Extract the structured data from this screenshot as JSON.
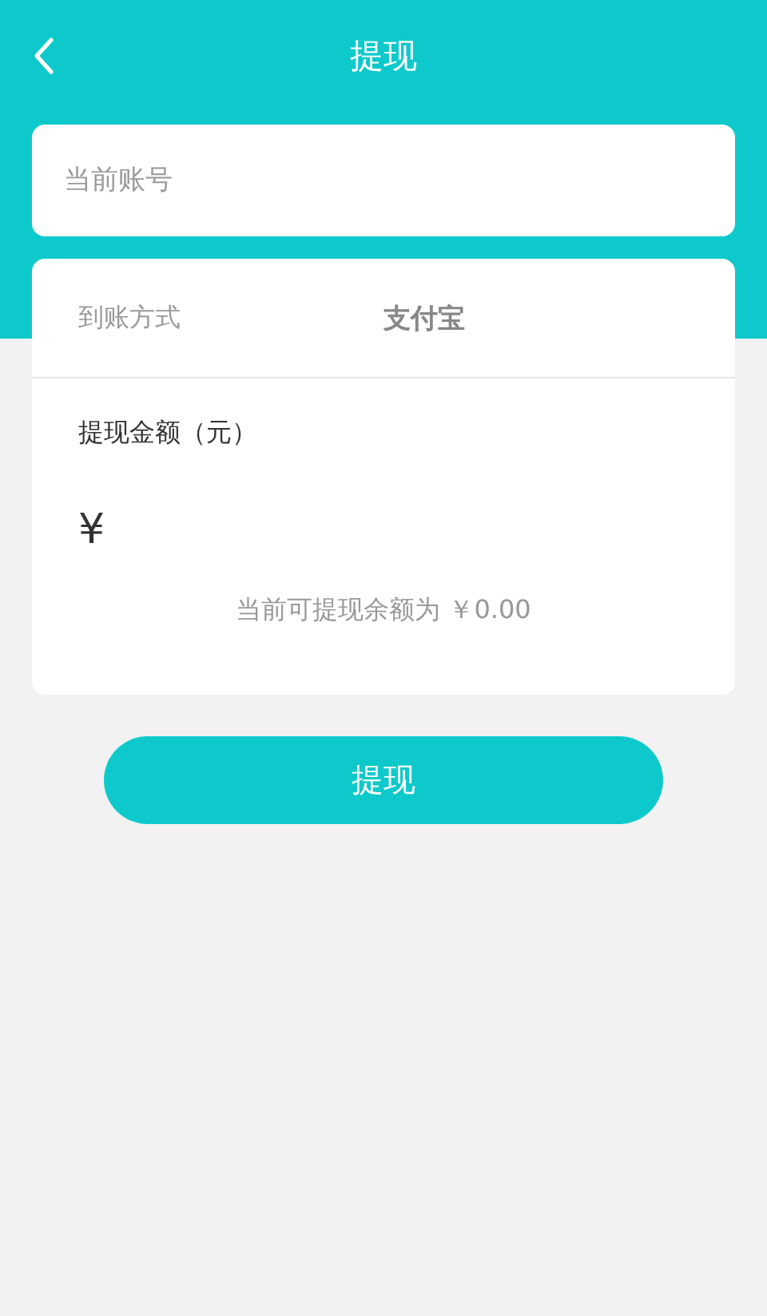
{
  "header": {
    "title": "提现"
  },
  "account": {
    "placeholder": "当前账号"
  },
  "method": {
    "label": "到账方式",
    "value": "支付宝"
  },
  "amount": {
    "label": "提现金额（元）",
    "currency": "¥",
    "balance_note": "当前可提现余额为 ￥0.00"
  },
  "submit": "提现"
}
